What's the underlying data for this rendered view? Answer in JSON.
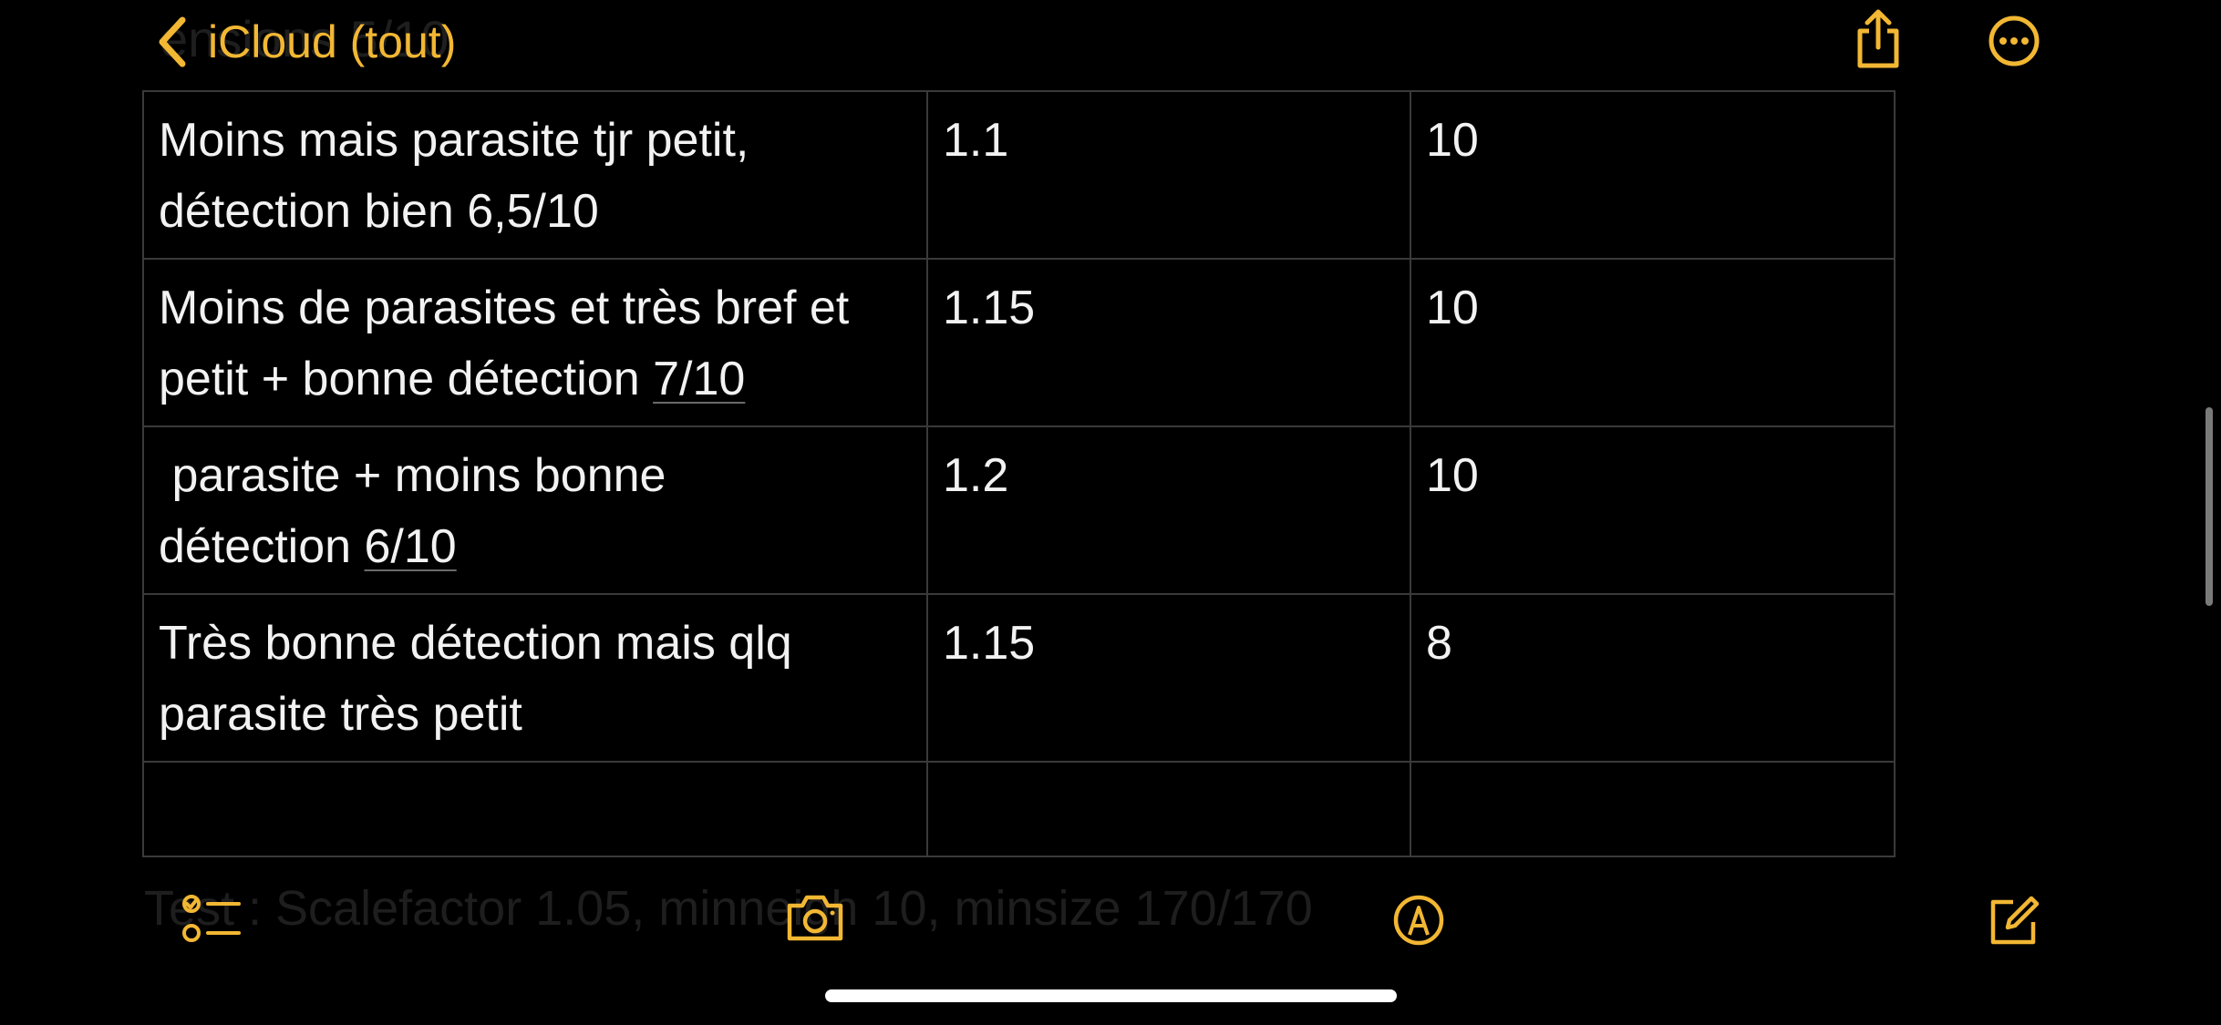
{
  "nav": {
    "back_label": "iCloud (tout)",
    "ghost_title": "ensions 5/10"
  },
  "table": {
    "rows": [
      {
        "c1_line1": "Moins mais parasite tjr petit,",
        "c1_line2": "détection bien 6,5/10",
        "c2": "1.1",
        "c3": "10"
      },
      {
        "c1_line1": "Moins de parasites et très bref et",
        "c1_line2_pre": "petit + bonne détection ",
        "c1_line2_u": "7/10",
        "c2": "1.15",
        "c3": "10"
      },
      {
        "c1_line1": " parasite + moins bonne",
        "c1_line2_pre": "détection ",
        "c1_line2_u": "6/10",
        "c2": "1.2",
        "c3": "10"
      },
      {
        "c1_line1": "Très bonne détection mais qlq",
        "c1_line2": "parasite très petit",
        "c2": "1.15",
        "c3": "8"
      },
      {
        "c1": "",
        "c2": "",
        "c3": ""
      }
    ]
  },
  "bottom": {
    "ghost_text": "Test : Scalefactor 1.05, minneigh 10, minsize 170/170"
  },
  "icons": {
    "back": "chevron-left-icon",
    "share": "share-icon",
    "more": "more-icon",
    "checklist": "checklist-icon",
    "camera": "camera-icon",
    "markup": "markup-icon",
    "compose": "compose-icon"
  },
  "colors": {
    "accent": "#f2b733",
    "background": "#000000",
    "text": "#f2f2f2",
    "grid": "#3a3a3a"
  }
}
